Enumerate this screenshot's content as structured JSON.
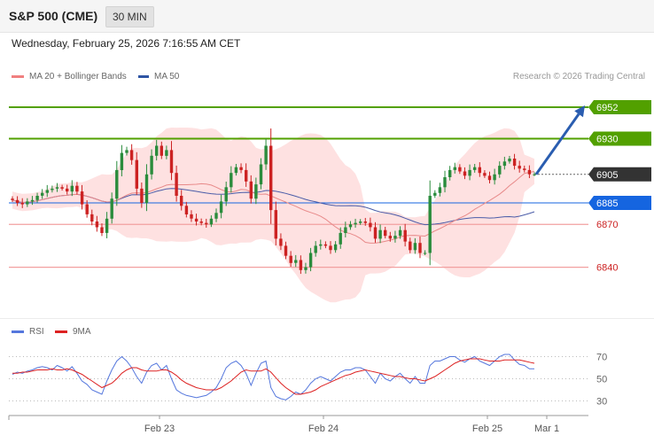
{
  "header": {
    "title": "S&P 500 (CME)",
    "timeframe": "30 MIN"
  },
  "subheader": {
    "datetime": "Wednesday, February 25, 2026 7:16:55 AM CET"
  },
  "legend": {
    "ma20_bb": "MA 20 + Bollinger Bands",
    "ma50": "MA 50",
    "credit": "Research © 2026 Trading Central"
  },
  "rsi_legend": {
    "rsi": "RSI",
    "ma9": "9MA"
  },
  "colors": {
    "bull": "#2a8c3c",
    "bear": "#cc2222",
    "band": "#fdd7d7",
    "ma20": "#e88a8a",
    "ma50": "#4a5ca8",
    "target": "#52a000",
    "pivot": "#1565e0",
    "support": "#f2a0a0",
    "current": "#333333",
    "arrow": "#2a5db0",
    "rsi": "#5577dd",
    "rsi_ma": "#dd2222"
  },
  "chart_data": [
    {
      "type": "candlestick",
      "title": "",
      "ylim": [
        6810,
        6965
      ],
      "x_ticks": [
        "Feb 23",
        "Feb 24",
        "Feb 25",
        "Mar 1"
      ],
      "levels": [
        {
          "label": "6952",
          "value": 6952,
          "kind": "target"
        },
        {
          "label": "6930",
          "value": 6930,
          "kind": "target"
        },
        {
          "label": "6905",
          "value": 6905,
          "kind": "current"
        },
        {
          "label": "6885",
          "value": 6885,
          "kind": "pivot"
        },
        {
          "label": "6870",
          "value": 6870,
          "kind": "support"
        },
        {
          "label": "6840",
          "value": 6840,
          "kind": "support"
        }
      ],
      "forecast": {
        "from": 6905,
        "to": 6952
      },
      "close": [
        6887,
        6885,
        6884,
        6886,
        6887,
        6890,
        6892,
        6894,
        6895,
        6896,
        6895,
        6893,
        6897,
        6893,
        6884,
        6877,
        6872,
        6868,
        6864,
        6874,
        6888,
        6908,
        6920,
        6922,
        6915,
        6895,
        6885,
        6905,
        6918,
        6925,
        6918,
        6922,
        6906,
        6890,
        6883,
        6877,
        6874,
        6872,
        6871,
        6870,
        6874,
        6878,
        6886,
        6896,
        6906,
        6910,
        6908,
        6900,
        6888,
        6898,
        6912,
        6925,
        6880,
        6860,
        6855,
        6848,
        6843,
        6845,
        6838,
        6840,
        6850,
        6855,
        6856,
        6855,
        6852,
        6856,
        6864,
        6868,
        6870,
        6871,
        6872,
        6871,
        6868,
        6860,
        6866,
        6862,
        6860,
        6862,
        6866,
        6858,
        6852,
        6857,
        6850,
        6850,
        6890,
        6892,
        6896,
        6903,
        6908,
        6910,
        6907,
        6904,
        6908,
        6910,
        6906,
        6904,
        6901,
        6905,
        6911,
        6914,
        6916,
        6911,
        6909,
        6908,
        6905,
        6905
      ],
      "rsi": {
        "ylim": [
          20,
          80
        ],
        "ticks": [
          70,
          50,
          30
        ],
        "rsi": [
          54,
          56,
          55,
          57,
          58,
          60,
          61,
          60,
          58,
          62,
          60,
          57,
          61,
          55,
          48,
          45,
          40,
          38,
          36,
          48,
          58,
          66,
          70,
          66,
          60,
          52,
          46,
          56,
          62,
          64,
          58,
          62,
          50,
          40,
          37,
          35,
          34,
          33,
          34,
          35,
          38,
          42,
          50,
          60,
          64,
          66,
          62,
          55,
          44,
          55,
          64,
          66,
          42,
          34,
          32,
          31,
          34,
          38,
          36,
          40,
          46,
          50,
          52,
          50,
          48,
          52,
          56,
          58,
          58,
          60,
          60,
          58,
          52,
          46,
          55,
          50,
          48,
          52,
          55,
          50,
          46,
          52,
          46,
          46,
          62,
          66,
          66,
          68,
          70,
          70,
          67,
          65,
          68,
          70,
          66,
          64,
          62,
          66,
          70,
          72,
          72,
          67,
          63,
          62,
          59,
          59
        ],
        "ma9": [
          55,
          55,
          56,
          56,
          57,
          58,
          58,
          58,
          59,
          58,
          58,
          59,
          58,
          56,
          54,
          51,
          48,
          45,
          42,
          44,
          46,
          50,
          55,
          58,
          60,
          60,
          58,
          57,
          57,
          57,
          58,
          58,
          56,
          53,
          49,
          46,
          44,
          42,
          41,
          40,
          40,
          40,
          42,
          45,
          48,
          52,
          56,
          58,
          57,
          57,
          57,
          59,
          56,
          51,
          46,
          42,
          39,
          36,
          36,
          37,
          38,
          40,
          43,
          45,
          47,
          49,
          51,
          53,
          54,
          56,
          57,
          58,
          57,
          56,
          55,
          54,
          53,
          52,
          52,
          51,
          50,
          50,
          49,
          48,
          50,
          52,
          55,
          58,
          61,
          64,
          66,
          67,
          68,
          68,
          68,
          67,
          66,
          66,
          66,
          67,
          67,
          67,
          67,
          66,
          65,
          64
        ]
      }
    }
  ]
}
